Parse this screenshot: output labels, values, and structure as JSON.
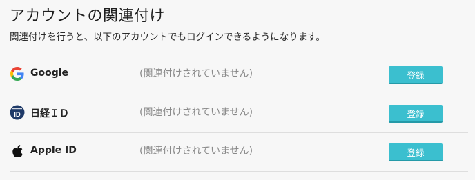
{
  "page": {
    "title": "アカウントの関連付け",
    "description": "関連付けを行うと、以下のアカウントでもログインできるようになります。"
  },
  "providers": [
    {
      "name": "Google",
      "icon": "google-icon",
      "status": "(関連付けされていません)",
      "button_label": "登録"
    },
    {
      "name": "日経ＩＤ",
      "icon": "nikkei-id-icon",
      "icon_text": "ID",
      "status": "(関連付けされていません)",
      "button_label": "登録"
    },
    {
      "name": "Apple ID",
      "icon": "apple-icon",
      "status": "(関連付けされていません)",
      "button_label": "登録"
    }
  ],
  "colors": {
    "button_bg": "#3bbfcf",
    "status_text": "#8a8a8a",
    "divider": "#dedede",
    "nikkei_navy": "#1f3a68"
  }
}
